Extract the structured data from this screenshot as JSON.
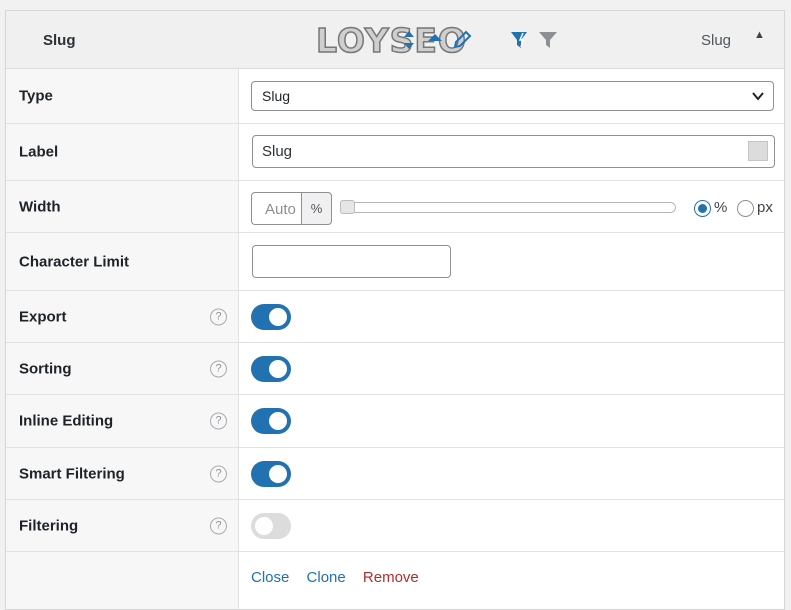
{
  "header": {
    "title": "Slug",
    "right_label": "Slug",
    "watermark": "LOYSEO"
  },
  "rows": {
    "type": {
      "label": "Type",
      "value": "Slug"
    },
    "label": {
      "label": "Label",
      "value": "Slug"
    },
    "width": {
      "label": "Width",
      "placeholder": "Auto",
      "unit": "%",
      "option_percent": "%",
      "option_px": "px",
      "selected": "%",
      "slider_value": 0
    },
    "char_limit": {
      "label": "Character Limit",
      "value": ""
    },
    "export": {
      "label": "Export",
      "help": "?",
      "enabled": true
    },
    "sorting": {
      "label": "Sorting",
      "help": "?",
      "enabled": true
    },
    "inline_editing": {
      "label": "Inline Editing",
      "help": "?",
      "enabled": true
    },
    "smart_filtering": {
      "label": "Smart Filtering",
      "help": "?",
      "enabled": true
    },
    "filtering": {
      "label": "Filtering",
      "help": "?",
      "enabled": false
    }
  },
  "actions": {
    "close": "Close",
    "clone": "Clone",
    "remove": "Remove"
  },
  "colors": {
    "accent": "#2271b1",
    "danger": "#b32d2e",
    "toggle_off": "#dcdcdc"
  }
}
